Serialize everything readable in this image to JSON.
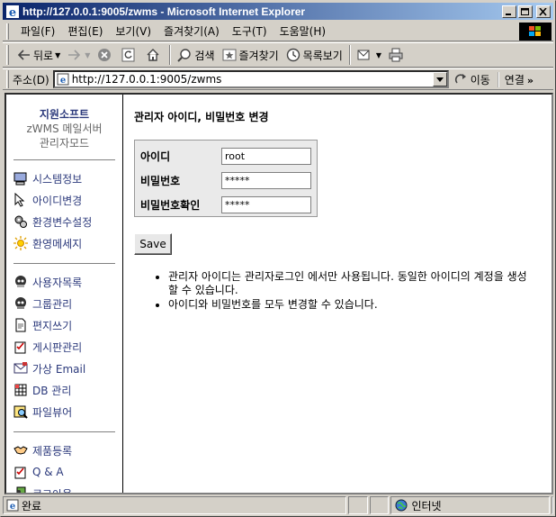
{
  "window": {
    "title": "http://127.0.0.1:9005/zwms - Microsoft Internet Explorer"
  },
  "menubar": {
    "items": [
      "파일(F)",
      "편집(E)",
      "보기(V)",
      "즐겨찾기(A)",
      "도구(T)",
      "도움말(H)"
    ]
  },
  "toolbar": {
    "back_label": "뒤로",
    "search_label": "검색",
    "favorites_label": "즐겨찾기",
    "history_label": "목록보기"
  },
  "addressbar": {
    "label": "주소(D)",
    "url": "http://127.0.0.1:9005/zwms",
    "go_label": "이동",
    "links_label": "연결"
  },
  "sidebar": {
    "brand_name": "지원소프트",
    "brand_sub1": "zWMS 메일서버",
    "brand_sub2": "관리자모드",
    "groups": [
      [
        {
          "label": "시스템정보",
          "icon": "computer-icon"
        },
        {
          "label": "아이디변경",
          "icon": "cursor-icon"
        },
        {
          "label": "환경변수설정",
          "icon": "gears-icon"
        },
        {
          "label": "환영메세지",
          "icon": "sun-icon"
        }
      ],
      [
        {
          "label": "사용자목록",
          "icon": "users-icon"
        },
        {
          "label": "그룹관리",
          "icon": "group-icon"
        },
        {
          "label": "편지쓰기",
          "icon": "document-icon"
        },
        {
          "label": "게시판관리",
          "icon": "checklist-icon"
        },
        {
          "label": "가상 Email",
          "icon": "mail-icon"
        },
        {
          "label": "DB 관리",
          "icon": "database-icon"
        },
        {
          "label": "파일뷰어",
          "icon": "file-viewer-icon"
        }
      ],
      [
        {
          "label": "제품등록",
          "icon": "handshake-icon"
        },
        {
          "label": "Q & A",
          "icon": "question-icon"
        },
        {
          "label": "로그아웃",
          "icon": "logout-icon"
        }
      ]
    ]
  },
  "content": {
    "title": "관리자 아이디, 비밀번호 변경",
    "fields": {
      "id_label": "아이디",
      "id_value": "root",
      "pw_label": "비밀번호",
      "pw_value": "*****",
      "pw_confirm_label": "비밀번호확인",
      "pw_confirm_value": "*****"
    },
    "save_label": "Save",
    "notes": [
      "관리자 아이디는 관리자로그인 에서만 사용됩니다. 동일한 아이디의 계정을 생성할 수 있습니다.",
      "아이디와 비밀번호를 모두 변경할 수 있습니다."
    ]
  },
  "statusbar": {
    "status": "완료",
    "zone": "인터넷"
  },
  "colors": {
    "title_gradient_start": "#0a246a",
    "title_gradient_end": "#a6caf0",
    "link_color": "#2c3a7c",
    "chrome": "#d4d0c8"
  }
}
